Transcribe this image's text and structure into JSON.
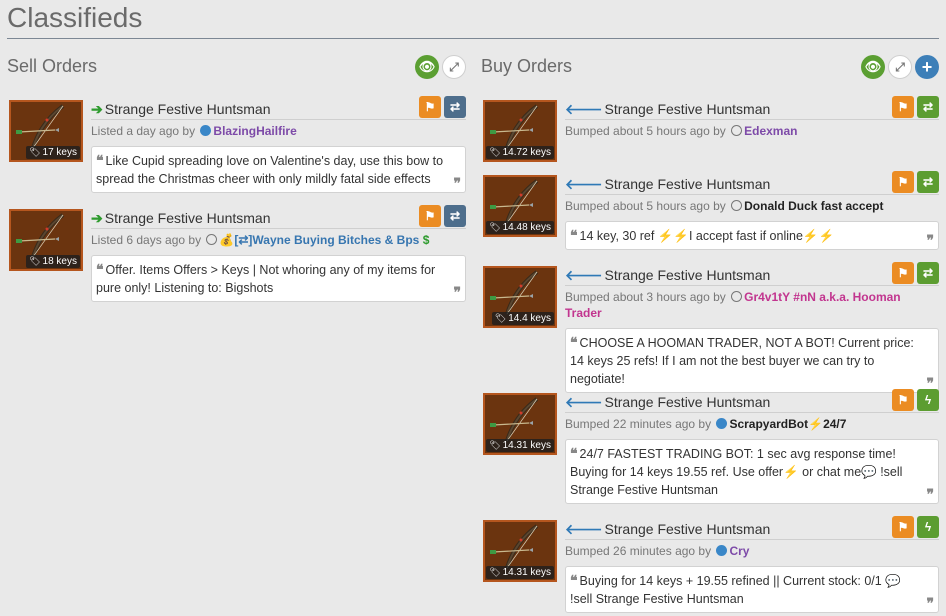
{
  "page": {
    "title": "Classifieds"
  },
  "sell": {
    "title": "Sell Orders",
    "tool_icons": [
      "eye-icon",
      "expand-icon"
    ],
    "listings": [
      {
        "item": "Strange Festive Huntsman",
        "price": "17 keys",
        "meta_prefix": "Listed a day ago by",
        "user_status": "online",
        "user": "BlazingHailfire",
        "user_prefix": "",
        "user_suffix": "",
        "comment": "Like Cupid spreading love on Valentine's day, use this bow to spread the Christmas cheer with only mildly fatal side effects",
        "buttons": [
          "flag-icon",
          "trade-icon"
        ]
      },
      {
        "item": "Strange Festive Huntsman",
        "price": "18 keys",
        "meta_prefix": "Listed 6 days ago by",
        "user_status": "offline",
        "user_prefix": "💰",
        "user": "[⇄]Wayne Buying Bitches & Bps",
        "user_suffix": "$",
        "comment": "Offer. Items Offers > Keys | Not whoring any of my items for pure only! Listening to: Bigshots",
        "buttons": [
          "flag-icon",
          "trade-icon"
        ]
      }
    ]
  },
  "buy": {
    "title": "Buy Orders",
    "tool_icons": [
      "eye-icon",
      "expand-icon",
      "plus-icon"
    ],
    "listings": [
      {
        "item": "Strange Festive Huntsman",
        "price": "14.72 keys",
        "meta_prefix": "Bumped about 5 hours ago by",
        "user_status": "offline",
        "user": "Edexman",
        "user_suffix": "",
        "comment": "",
        "buttons": [
          "flag-icon",
          "exchange-icon"
        ]
      },
      {
        "item": "Strange Festive Huntsman",
        "price": "14.48 keys",
        "meta_prefix": "Bumped about 5 hours ago by",
        "user_status": "offline",
        "user": "Donald Duck fast accept",
        "user_suffix": "",
        "comment": "14 key, 30 ref ⚡⚡I accept fast if online⚡⚡",
        "buttons": [
          "flag-icon",
          "exchange-icon"
        ]
      },
      {
        "item": "Strange Festive Huntsman",
        "price": "14.4 keys",
        "meta_prefix": "Bumped about 3 hours ago by",
        "user_status": "offline",
        "user": "Gr4v1tY #nN a.k.a. Hooman Trader",
        "user_suffix": "",
        "comment": "CHOOSE A HOOMAN TRADER, NOT A BOT! Current price: 14 keys 25 refs! If I am not the best buyer we can try to negotiate!",
        "buttons": [
          "flag-icon",
          "exchange-icon"
        ]
      },
      {
        "item": "Strange Festive Huntsman",
        "price": "14.31 keys",
        "meta_prefix": "Bumped 22 minutes ago by",
        "user_status": "online",
        "user": "ScrapyardBot⚡24/7",
        "user_suffix": "",
        "comment": "24/7 FASTEST TRADING BOT: 1 sec avg response time! Buying for 14 keys 19.55 ref. Use offer⚡ or chat me💬 !sell Strange Festive Huntsman",
        "buttons": [
          "flag-icon",
          "lightning-icon"
        ]
      },
      {
        "item": "Strange Festive Huntsman",
        "price": "14.31 keys",
        "meta_prefix": "Bumped 26 minutes ago by",
        "user_status": "online",
        "user": "Cry",
        "user_suffix": "",
        "comment": "Buying for 14 keys + 19.55 refined || Current stock: 0/1 💬 !sell Strange Festive Huntsman",
        "buttons": [
          "flag-icon",
          "lightning-icon"
        ]
      }
    ]
  }
}
